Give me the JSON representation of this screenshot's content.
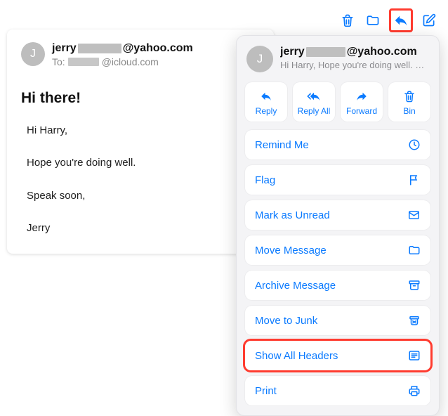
{
  "toolbar": {
    "trash": "trash",
    "archive": "archive",
    "reply": "reply",
    "compose": "compose"
  },
  "email": {
    "avatar_letter": "J",
    "from_prefix": "jerry",
    "from_suffix": "@yahoo.com",
    "to_label": "To:",
    "to_suffix": "@icloud.com",
    "subject": "Hi there!",
    "body": {
      "p1": "Hi Harry,",
      "p2": "Hope you're doing well.",
      "p3": "Speak soon,",
      "p4": "Jerry"
    }
  },
  "popover": {
    "avatar_letter": "J",
    "from_prefix": "jerry",
    "from_suffix": "@yahoo.com",
    "preview": "Hi Harry, Hope you're doing well. …",
    "actions": {
      "reply": "Reply",
      "reply_all": "Reply All",
      "forward": "Forward",
      "bin": "Bin"
    },
    "menu": {
      "remind_me": "Remind Me",
      "flag": "Flag",
      "mark_unread": "Mark as Unread",
      "move_message": "Move Message",
      "archive_message": "Archive Message",
      "move_to_junk": "Move to Junk",
      "show_headers": "Show All Headers",
      "print": "Print"
    }
  }
}
